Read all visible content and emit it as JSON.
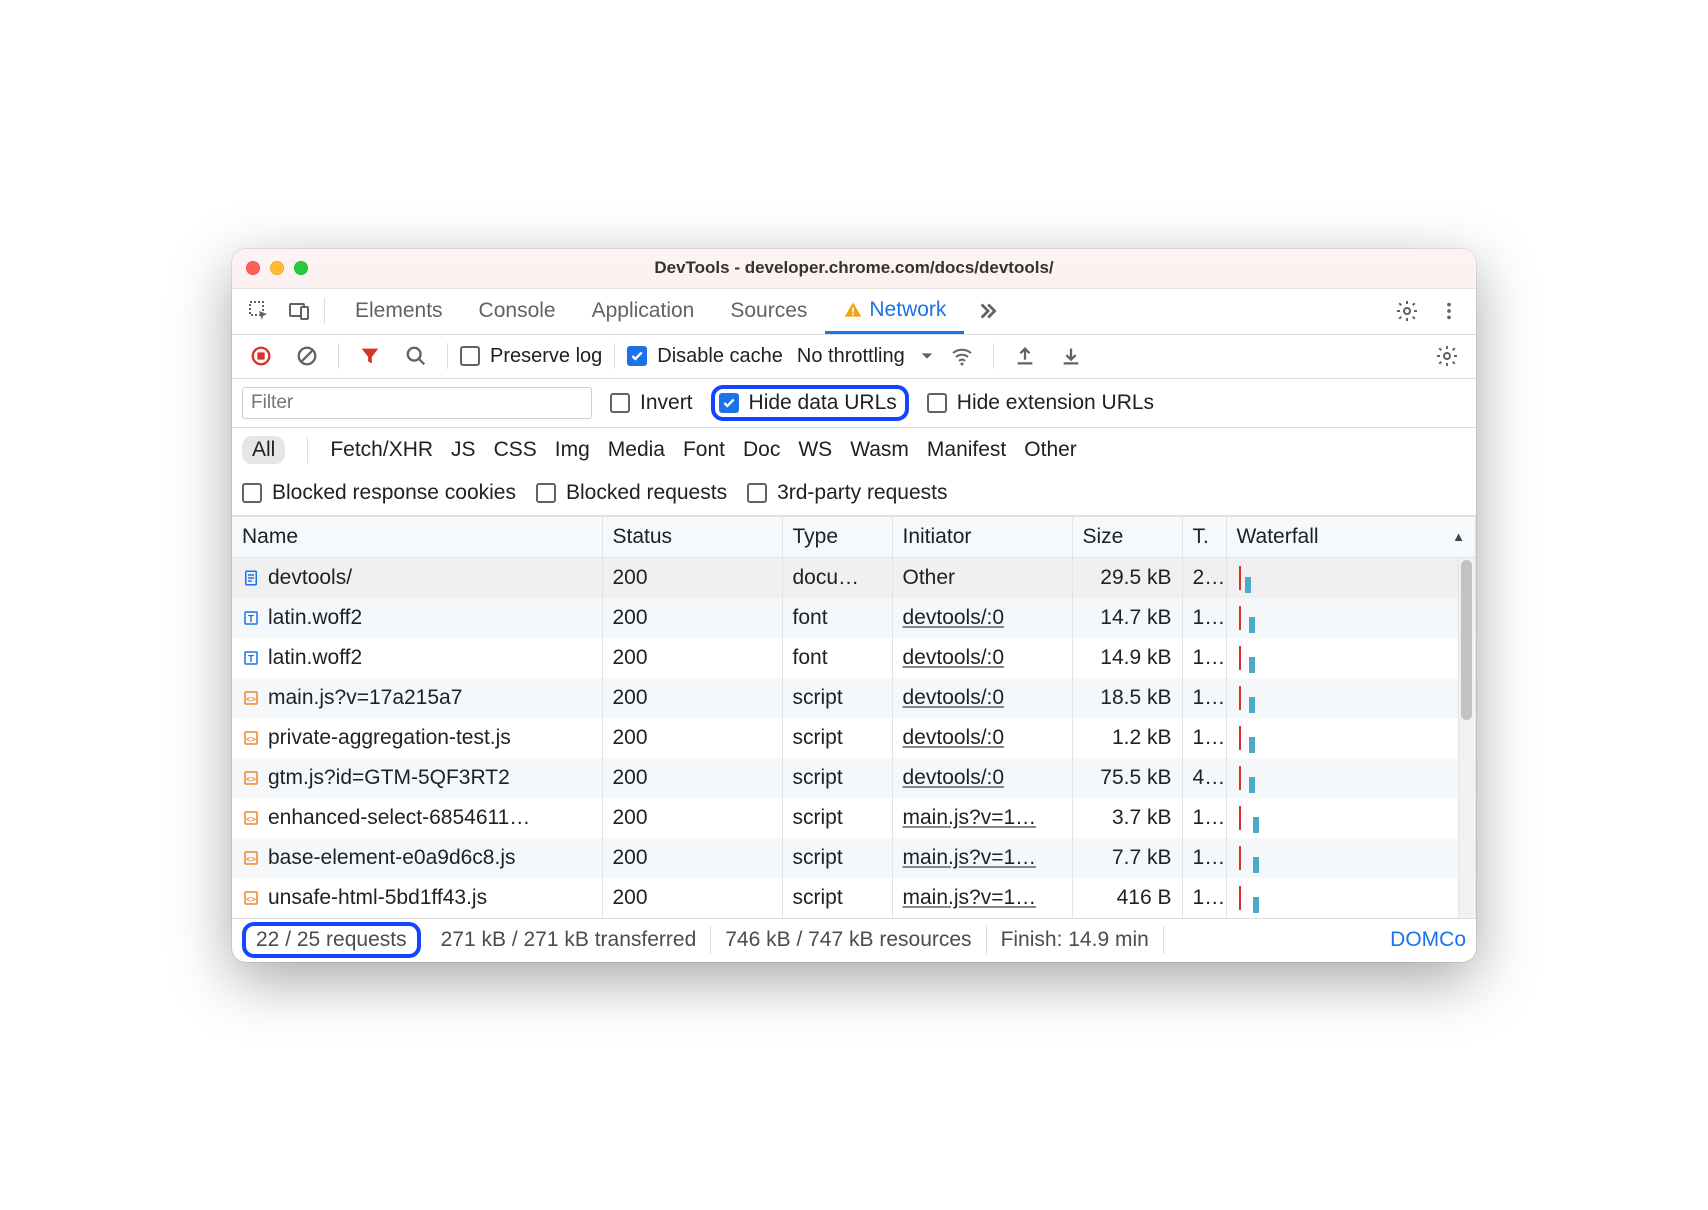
{
  "window": {
    "title": "DevTools - developer.chrome.com/docs/devtools/"
  },
  "tabs": {
    "items": [
      "Elements",
      "Console",
      "Application",
      "Sources",
      "Network"
    ],
    "active": "Network",
    "warning_on": "Network"
  },
  "toolbar": {
    "preserve_log": "Preserve log",
    "disable_cache": "Disable cache",
    "throttling": "No throttling"
  },
  "filter": {
    "placeholder": "Filter",
    "invert": "Invert",
    "hide_data_urls": "Hide data URLs",
    "hide_ext_urls": "Hide extension URLs",
    "types": [
      "All",
      "Fetch/XHR",
      "JS",
      "CSS",
      "Img",
      "Media",
      "Font",
      "Doc",
      "WS",
      "Wasm",
      "Manifest",
      "Other"
    ],
    "type_selected": "All",
    "blocked_cookies": "Blocked response cookies",
    "blocked_requests": "Blocked requests",
    "third_party": "3rd-party requests"
  },
  "table": {
    "columns": {
      "name": "Name",
      "status": "Status",
      "type": "Type",
      "initiator": "Initiator",
      "size": "Size",
      "time": "T.",
      "waterfall": "Waterfall"
    },
    "rows": [
      {
        "icon": "doc",
        "name": "devtools/",
        "status": "200",
        "type": "docu…",
        "initiator": "Other",
        "initiator_link": false,
        "size": "29.5 kB",
        "time": "2..",
        "wf": 8
      },
      {
        "icon": "font",
        "name": "latin.woff2",
        "status": "200",
        "type": "font",
        "initiator": "devtools/:0",
        "initiator_link": true,
        "size": "14.7 kB",
        "time": "1..",
        "wf": 12
      },
      {
        "icon": "font",
        "name": "latin.woff2",
        "status": "200",
        "type": "font",
        "initiator": "devtools/:0",
        "initiator_link": true,
        "size": "14.9 kB",
        "time": "1..",
        "wf": 12
      },
      {
        "icon": "js",
        "name": "main.js?v=17a215a7",
        "status": "200",
        "type": "script",
        "initiator": "devtools/:0",
        "initiator_link": true,
        "size": "18.5 kB",
        "time": "1..",
        "wf": 12
      },
      {
        "icon": "js",
        "name": "private-aggregation-test.js",
        "status": "200",
        "type": "script",
        "initiator": "devtools/:0",
        "initiator_link": true,
        "size": "1.2 kB",
        "time": "1..",
        "wf": 12
      },
      {
        "icon": "js",
        "name": "gtm.js?id=GTM-5QF3RT2",
        "status": "200",
        "type": "script",
        "initiator": "devtools/:0",
        "initiator_link": true,
        "size": "75.5 kB",
        "time": "4..",
        "wf": 12
      },
      {
        "icon": "js",
        "name": "enhanced-select-6854611…",
        "status": "200",
        "type": "script",
        "initiator": "main.js?v=1…",
        "initiator_link": true,
        "size": "3.7 kB",
        "time": "1..",
        "wf": 16
      },
      {
        "icon": "js",
        "name": "base-element-e0a9d6c8.js",
        "status": "200",
        "type": "script",
        "initiator": "main.js?v=1…",
        "initiator_link": true,
        "size": "7.7 kB",
        "time": "1..",
        "wf": 16
      },
      {
        "icon": "js",
        "name": "unsafe-html-5bd1ff43.js",
        "status": "200",
        "type": "script",
        "initiator": "main.js?v=1…",
        "initiator_link": true,
        "size": "416 B",
        "time": "1..",
        "wf": 16
      }
    ]
  },
  "status": {
    "requests": "22 / 25 requests",
    "transferred": "271 kB / 271 kB transferred",
    "resources": "746 kB / 747 kB resources",
    "finish": "Finish: 14.9 min",
    "domco": "DOMCo"
  }
}
